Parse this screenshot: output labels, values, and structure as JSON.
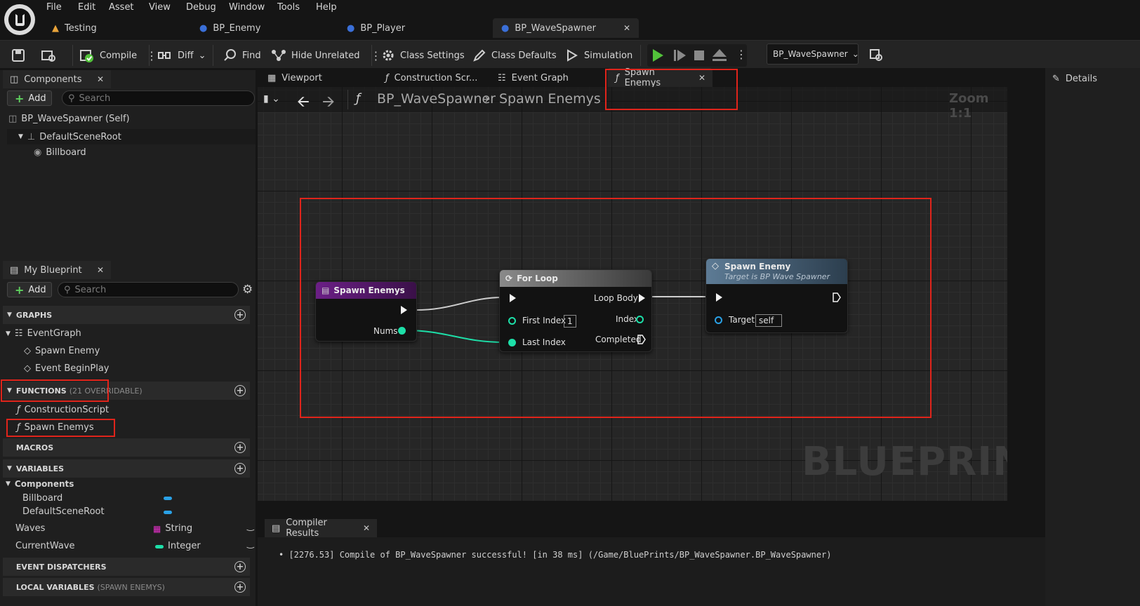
{
  "menu": [
    "File",
    "Edit",
    "Asset",
    "View",
    "Debug",
    "Window",
    "Tools",
    "Help"
  ],
  "doc_tabs": [
    {
      "label": "Testing",
      "icon": "warning-level-icon"
    },
    {
      "label": "BP_Enemy",
      "icon": "pawn-icon"
    },
    {
      "label": "BP_Player",
      "icon": "pawn-icon"
    },
    {
      "label": "BP_WaveSpawner",
      "icon": "actor-icon",
      "active": true
    }
  ],
  "toolbar": {
    "compile": "Compile",
    "diff": "Diff",
    "find": "Find",
    "hide_unrelated": "Hide Unrelated",
    "class_settings": "Class Settings",
    "class_defaults": "Class Defaults",
    "simulation": "Simulation",
    "debug_object": "BP_WaveSpawner"
  },
  "components": {
    "tab": "Components",
    "add": "Add",
    "search_placeholder": "Search",
    "tree": [
      "BP_WaveSpawner (Self)",
      "DefaultSceneRoot",
      "Billboard"
    ]
  },
  "my_blueprint": {
    "tab": "My Blueprint",
    "add": "Add",
    "search_placeholder": "Search",
    "graphs_header": "GRAPHS",
    "graphs": [
      "EventGraph",
      "Spawn Enemy",
      "Event BeginPlay"
    ],
    "functions_header": "FUNCTIONS",
    "functions_note": "(21 OVERRIDABLE)",
    "functions": [
      "ConstructionScript",
      "Spawn Enemys"
    ],
    "macros_header": "MACROS",
    "variables_header": "VARIABLES",
    "var_category": "Components",
    "component_vars": [
      "Billboard",
      "DefaultSceneRoot"
    ],
    "vars": [
      {
        "name": "Waves",
        "type": "String",
        "color": "#e52fc9"
      },
      {
        "name": "CurrentWave",
        "type": "Integer",
        "color": "#1ddfa8"
      }
    ],
    "dispatchers_header": "EVENT DISPATCHERS",
    "local_vars_header": "LOCAL VARIABLES",
    "local_vars_note": "(SPAWN ENEMYS)"
  },
  "editor_tabs": [
    "Viewport",
    "Construction Scr...",
    "Event Graph",
    "Spawn Enemys"
  ],
  "breadcrumb": {
    "blueprint": "BP_WaveSpawner",
    "graph": "Spawn Enemys",
    "zoom": "Zoom 1:1"
  },
  "details_tab": "Details",
  "nodes": {
    "entry": {
      "title": "Spawn Enemys",
      "pin": "Nums"
    },
    "for_loop": {
      "title": "For Loop",
      "first_index": "First Index",
      "first_index_value": "1",
      "last_index": "Last Index",
      "loop_body": "Loop Body",
      "index": "Index",
      "completed": "Completed"
    },
    "spawn": {
      "title": "Spawn Enemy",
      "subtitle": "Target is BP Wave Spawner",
      "target": "Target",
      "target_value": "self"
    }
  },
  "watermark": "BLUEPRINT",
  "compiler": {
    "tab": "Compiler Results",
    "message": "[2276.53] Compile of BP_WaveSpawner successful! [in 38 ms] (/Game/BluePrints/BP_WaveSpawner.BP_WaveSpawner)"
  },
  "colors": {
    "accent_red": "#e0241b",
    "exec": "#f2f2f2",
    "integer": "#1ddfa8",
    "object": "#2aa1e6",
    "play_green": "#52c23a"
  }
}
